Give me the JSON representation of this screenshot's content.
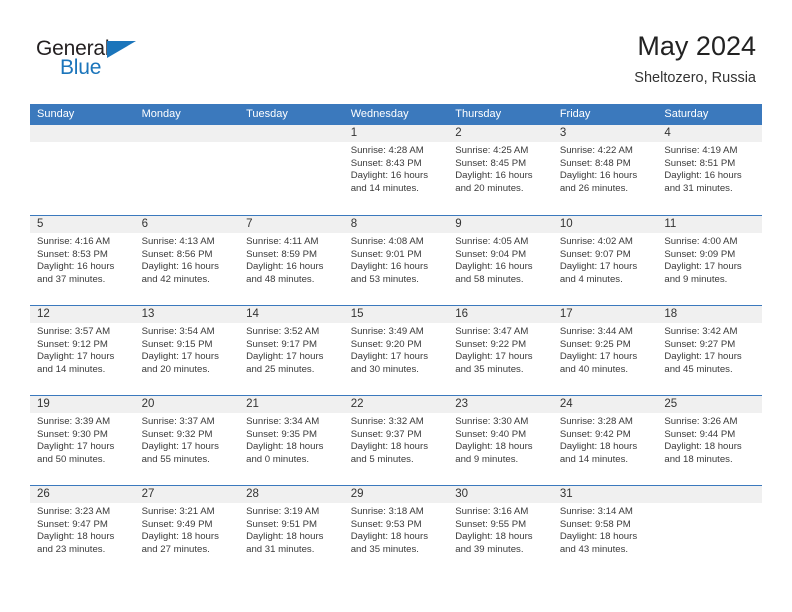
{
  "brand": {
    "name_part1": "General",
    "name_part2": "Blue",
    "triangle_icon": "triangle-icon",
    "accent_color": "#1b75bb"
  },
  "header": {
    "title": "May 2024",
    "location": "Sheltozero, Russia",
    "header_bg_color": "#3b79bd",
    "band_bg_color": "#f0f0f0"
  },
  "weekdays": [
    "Sunday",
    "Monday",
    "Tuesday",
    "Wednesday",
    "Thursday",
    "Friday",
    "Saturday"
  ],
  "weeks": [
    [
      {
        "day": "",
        "sunrise": "",
        "sunset": "",
        "daylight_line1": "",
        "daylight_line2": "",
        "empty": true
      },
      {
        "day": "",
        "sunrise": "",
        "sunset": "",
        "daylight_line1": "",
        "daylight_line2": "",
        "empty": true
      },
      {
        "day": "",
        "sunrise": "",
        "sunset": "",
        "daylight_line1": "",
        "daylight_line2": "",
        "empty": true
      },
      {
        "day": "1",
        "sunrise": "Sunrise: 4:28 AM",
        "sunset": "Sunset: 8:43 PM",
        "daylight_line1": "Daylight: 16 hours",
        "daylight_line2": "and 14 minutes."
      },
      {
        "day": "2",
        "sunrise": "Sunrise: 4:25 AM",
        "sunset": "Sunset: 8:45 PM",
        "daylight_line1": "Daylight: 16 hours",
        "daylight_line2": "and 20 minutes."
      },
      {
        "day": "3",
        "sunrise": "Sunrise: 4:22 AM",
        "sunset": "Sunset: 8:48 PM",
        "daylight_line1": "Daylight: 16 hours",
        "daylight_line2": "and 26 minutes."
      },
      {
        "day": "4",
        "sunrise": "Sunrise: 4:19 AM",
        "sunset": "Sunset: 8:51 PM",
        "daylight_line1": "Daylight: 16 hours",
        "daylight_line2": "and 31 minutes."
      }
    ],
    [
      {
        "day": "5",
        "sunrise": "Sunrise: 4:16 AM",
        "sunset": "Sunset: 8:53 PM",
        "daylight_line1": "Daylight: 16 hours",
        "daylight_line2": "and 37 minutes."
      },
      {
        "day": "6",
        "sunrise": "Sunrise: 4:13 AM",
        "sunset": "Sunset: 8:56 PM",
        "daylight_line1": "Daylight: 16 hours",
        "daylight_line2": "and 42 minutes."
      },
      {
        "day": "7",
        "sunrise": "Sunrise: 4:11 AM",
        "sunset": "Sunset: 8:59 PM",
        "daylight_line1": "Daylight: 16 hours",
        "daylight_line2": "and 48 minutes."
      },
      {
        "day": "8",
        "sunrise": "Sunrise: 4:08 AM",
        "sunset": "Sunset: 9:01 PM",
        "daylight_line1": "Daylight: 16 hours",
        "daylight_line2": "and 53 minutes."
      },
      {
        "day": "9",
        "sunrise": "Sunrise: 4:05 AM",
        "sunset": "Sunset: 9:04 PM",
        "daylight_line1": "Daylight: 16 hours",
        "daylight_line2": "and 58 minutes."
      },
      {
        "day": "10",
        "sunrise": "Sunrise: 4:02 AM",
        "sunset": "Sunset: 9:07 PM",
        "daylight_line1": "Daylight: 17 hours",
        "daylight_line2": "and 4 minutes."
      },
      {
        "day": "11",
        "sunrise": "Sunrise: 4:00 AM",
        "sunset": "Sunset: 9:09 PM",
        "daylight_line1": "Daylight: 17 hours",
        "daylight_line2": "and 9 minutes."
      }
    ],
    [
      {
        "day": "12",
        "sunrise": "Sunrise: 3:57 AM",
        "sunset": "Sunset: 9:12 PM",
        "daylight_line1": "Daylight: 17 hours",
        "daylight_line2": "and 14 minutes."
      },
      {
        "day": "13",
        "sunrise": "Sunrise: 3:54 AM",
        "sunset": "Sunset: 9:15 PM",
        "daylight_line1": "Daylight: 17 hours",
        "daylight_line2": "and 20 minutes."
      },
      {
        "day": "14",
        "sunrise": "Sunrise: 3:52 AM",
        "sunset": "Sunset: 9:17 PM",
        "daylight_line1": "Daylight: 17 hours",
        "daylight_line2": "and 25 minutes."
      },
      {
        "day": "15",
        "sunrise": "Sunrise: 3:49 AM",
        "sunset": "Sunset: 9:20 PM",
        "daylight_line1": "Daylight: 17 hours",
        "daylight_line2": "and 30 minutes."
      },
      {
        "day": "16",
        "sunrise": "Sunrise: 3:47 AM",
        "sunset": "Sunset: 9:22 PM",
        "daylight_line1": "Daylight: 17 hours",
        "daylight_line2": "and 35 minutes."
      },
      {
        "day": "17",
        "sunrise": "Sunrise: 3:44 AM",
        "sunset": "Sunset: 9:25 PM",
        "daylight_line1": "Daylight: 17 hours",
        "daylight_line2": "and 40 minutes."
      },
      {
        "day": "18",
        "sunrise": "Sunrise: 3:42 AM",
        "sunset": "Sunset: 9:27 PM",
        "daylight_line1": "Daylight: 17 hours",
        "daylight_line2": "and 45 minutes."
      }
    ],
    [
      {
        "day": "19",
        "sunrise": "Sunrise: 3:39 AM",
        "sunset": "Sunset: 9:30 PM",
        "daylight_line1": "Daylight: 17 hours",
        "daylight_line2": "and 50 minutes."
      },
      {
        "day": "20",
        "sunrise": "Sunrise: 3:37 AM",
        "sunset": "Sunset: 9:32 PM",
        "daylight_line1": "Daylight: 17 hours",
        "daylight_line2": "and 55 minutes."
      },
      {
        "day": "21",
        "sunrise": "Sunrise: 3:34 AM",
        "sunset": "Sunset: 9:35 PM",
        "daylight_line1": "Daylight: 18 hours",
        "daylight_line2": "and 0 minutes."
      },
      {
        "day": "22",
        "sunrise": "Sunrise: 3:32 AM",
        "sunset": "Sunset: 9:37 PM",
        "daylight_line1": "Daylight: 18 hours",
        "daylight_line2": "and 5 minutes."
      },
      {
        "day": "23",
        "sunrise": "Sunrise: 3:30 AM",
        "sunset": "Sunset: 9:40 PM",
        "daylight_line1": "Daylight: 18 hours",
        "daylight_line2": "and 9 minutes."
      },
      {
        "day": "24",
        "sunrise": "Sunrise: 3:28 AM",
        "sunset": "Sunset: 9:42 PM",
        "daylight_line1": "Daylight: 18 hours",
        "daylight_line2": "and 14 minutes."
      },
      {
        "day": "25",
        "sunrise": "Sunrise: 3:26 AM",
        "sunset": "Sunset: 9:44 PM",
        "daylight_line1": "Daylight: 18 hours",
        "daylight_line2": "and 18 minutes."
      }
    ],
    [
      {
        "day": "26",
        "sunrise": "Sunrise: 3:23 AM",
        "sunset": "Sunset: 9:47 PM",
        "daylight_line1": "Daylight: 18 hours",
        "daylight_line2": "and 23 minutes."
      },
      {
        "day": "27",
        "sunrise": "Sunrise: 3:21 AM",
        "sunset": "Sunset: 9:49 PM",
        "daylight_line1": "Daylight: 18 hours",
        "daylight_line2": "and 27 minutes."
      },
      {
        "day": "28",
        "sunrise": "Sunrise: 3:19 AM",
        "sunset": "Sunset: 9:51 PM",
        "daylight_line1": "Daylight: 18 hours",
        "daylight_line2": "and 31 minutes."
      },
      {
        "day": "29",
        "sunrise": "Sunrise: 3:18 AM",
        "sunset": "Sunset: 9:53 PM",
        "daylight_line1": "Daylight: 18 hours",
        "daylight_line2": "and 35 minutes."
      },
      {
        "day": "30",
        "sunrise": "Sunrise: 3:16 AM",
        "sunset": "Sunset: 9:55 PM",
        "daylight_line1": "Daylight: 18 hours",
        "daylight_line2": "and 39 minutes."
      },
      {
        "day": "31",
        "sunrise": "Sunrise: 3:14 AM",
        "sunset": "Sunset: 9:58 PM",
        "daylight_line1": "Daylight: 18 hours",
        "daylight_line2": "and 43 minutes."
      },
      {
        "day": "",
        "sunrise": "",
        "sunset": "",
        "daylight_line1": "",
        "daylight_line2": "",
        "empty": true
      }
    ]
  ]
}
